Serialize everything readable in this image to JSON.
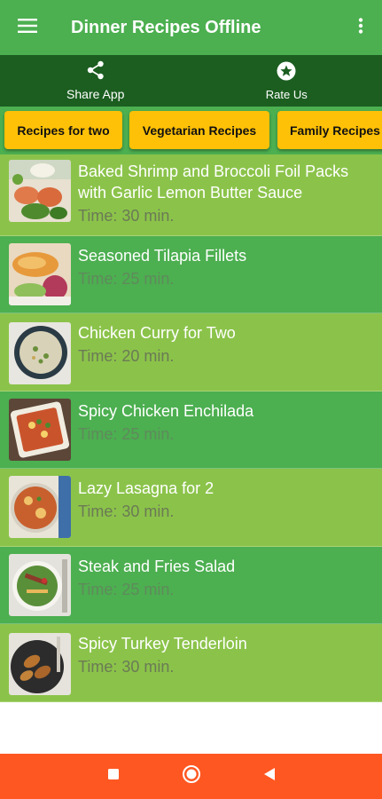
{
  "app": {
    "title": "Dinner Recipes Offline"
  },
  "actions": {
    "share_label": "Share App",
    "rate_label": "Rate Us"
  },
  "chips": [
    {
      "label": "Recipes for two"
    },
    {
      "label": "Vegetarian Recipes"
    },
    {
      "label": "Family Recipes"
    }
  ],
  "recipes": [
    {
      "title": "Baked Shrimp and Broccoli Foil Packs with Garlic Lemon Butter Sauce",
      "time": "Time: 30 min."
    },
    {
      "title": "Seasoned Tilapia Fillets",
      "time": "Time: 25 min."
    },
    {
      "title": "Chicken Curry for Two",
      "time": "Time: 20 min."
    },
    {
      "title": "Spicy Chicken Enchilada",
      "time": "Time: 25 min."
    },
    {
      "title": "Lazy Lasagna for 2",
      "time": "Time: 30 min."
    },
    {
      "title": "Steak and Fries Salad",
      "time": "Time: 25 min."
    },
    {
      "title": "Spicy Turkey Tenderloin",
      "time": "Time: 30 min."
    }
  ],
  "colors": {
    "appbar": "#4caf50",
    "actionbar": "#1b5e20",
    "chip": "#ffc107",
    "row_light": "#8bc34a",
    "row_dark": "#4caf50",
    "navbar": "#ff5722"
  },
  "icons": {
    "menu": "hamburger-menu-icon",
    "overflow": "more-vert-icon",
    "share": "share-icon",
    "rate": "star-circle-icon",
    "nav_recents": "square-icon",
    "nav_home": "circle-icon",
    "nav_back": "triangle-back-icon"
  }
}
